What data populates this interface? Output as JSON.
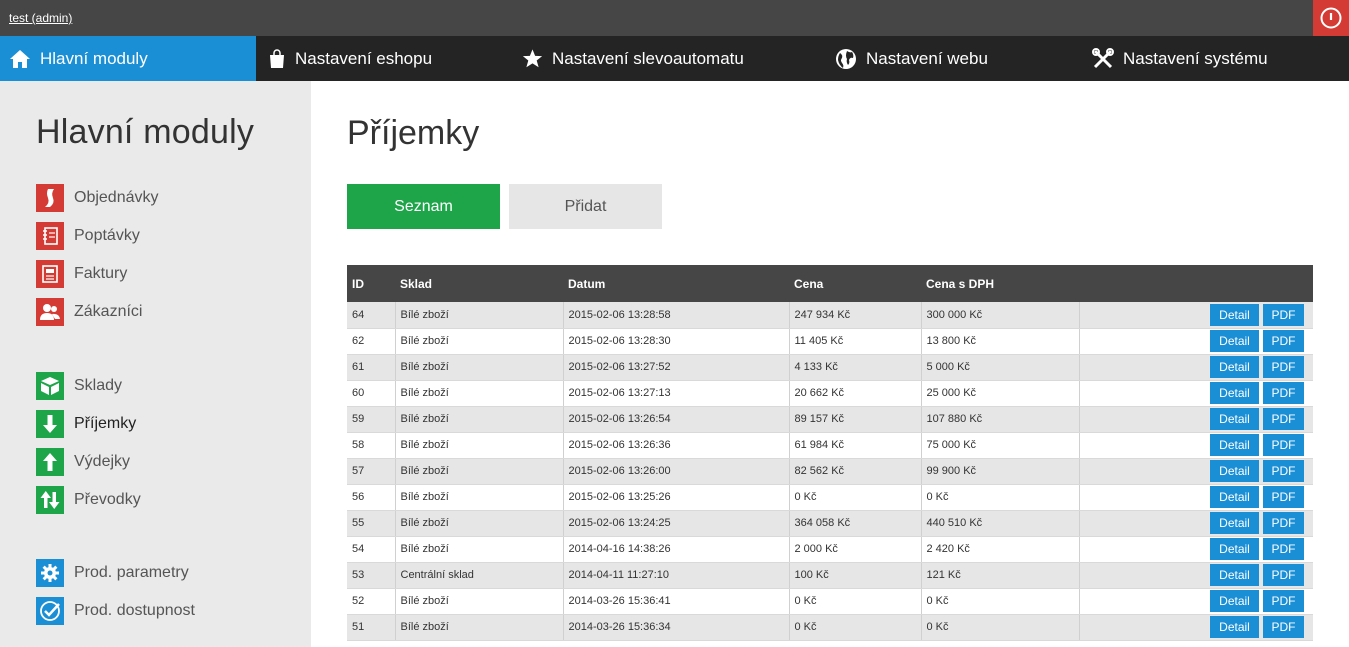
{
  "user": {
    "label": "test (admin)"
  },
  "nav": {
    "items": [
      {
        "label": "Hlavní moduly",
        "icon": "home-icon"
      },
      {
        "label": "Nastavení eshopu",
        "icon": "shopping-bag-icon"
      },
      {
        "label": "Nastavení slevoautomatu",
        "icon": "star-icon"
      },
      {
        "label": "Nastavení webu",
        "icon": "globe-icon"
      },
      {
        "label": "Nastavení systému",
        "icon": "tools-icon"
      }
    ]
  },
  "sidebar": {
    "title": "Hlavní moduly",
    "items": [
      {
        "label": "Objednávky",
        "icon": "order-icon",
        "color": "#d43b34"
      },
      {
        "label": "Poptávky",
        "icon": "notebook-icon",
        "color": "#d43b34"
      },
      {
        "label": "Faktury",
        "icon": "invoice-icon",
        "color": "#d43b34"
      },
      {
        "label": "Zákazníci",
        "icon": "customers-icon",
        "color": "#d43b34"
      },
      {
        "label": "Sklady",
        "icon": "warehouse-icon",
        "color": "#1ea54a"
      },
      {
        "label": "Příjemky",
        "icon": "arrow-down-icon",
        "color": "#1ea54a"
      },
      {
        "label": "Výdejky",
        "icon": "arrow-up-icon",
        "color": "#1ea54a"
      },
      {
        "label": "Převodky",
        "icon": "transfer-icon",
        "color": "#1ea54a"
      },
      {
        "label": "Prod. parametry",
        "icon": "gear-icon",
        "color": "#1b8fd6"
      },
      {
        "label": "Prod. dostupnost",
        "icon": "check-icon",
        "color": "#1b8fd6"
      }
    ]
  },
  "page": {
    "title": "Příjemky"
  },
  "tabs": {
    "list_label": "Seznam",
    "add_label": "Přidat"
  },
  "table": {
    "headers": [
      "ID",
      "Sklad",
      "Datum",
      "Cena",
      "Cena s DPH"
    ],
    "detail_label": "Detail",
    "pdf_label": "PDF",
    "rows": [
      {
        "id": "64",
        "sklad": "Bílé zboží",
        "datum": "2015-02-06 13:28:58",
        "cena": "247 934 Kč",
        "cena_dph": "300 000 Kč"
      },
      {
        "id": "62",
        "sklad": "Bílé zboží",
        "datum": "2015-02-06 13:28:30",
        "cena": "11 405 Kč",
        "cena_dph": "13 800 Kč"
      },
      {
        "id": "61",
        "sklad": "Bílé zboží",
        "datum": "2015-02-06 13:27:52",
        "cena": "4 133 Kč",
        "cena_dph": "5 000 Kč"
      },
      {
        "id": "60",
        "sklad": "Bílé zboží",
        "datum": "2015-02-06 13:27:13",
        "cena": "20 662 Kč",
        "cena_dph": "25 000 Kč"
      },
      {
        "id": "59",
        "sklad": "Bílé zboží",
        "datum": "2015-02-06 13:26:54",
        "cena": "89 157 Kč",
        "cena_dph": "107 880 Kč"
      },
      {
        "id": "58",
        "sklad": "Bílé zboží",
        "datum": "2015-02-06 13:26:36",
        "cena": "61 984 Kč",
        "cena_dph": "75 000 Kč"
      },
      {
        "id": "57",
        "sklad": "Bílé zboží",
        "datum": "2015-02-06 13:26:00",
        "cena": "82 562 Kč",
        "cena_dph": "99 900 Kč"
      },
      {
        "id": "56",
        "sklad": "Bílé zboží",
        "datum": "2015-02-06 13:25:26",
        "cena": "0 Kč",
        "cena_dph": "0 Kč"
      },
      {
        "id": "55",
        "sklad": "Bílé zboží",
        "datum": "2015-02-06 13:24:25",
        "cena": "364 058 Kč",
        "cena_dph": "440 510 Kč"
      },
      {
        "id": "54",
        "sklad": "Bílé zboží",
        "datum": "2014-04-16 14:38:26",
        "cena": "2 000 Kč",
        "cena_dph": "2 420 Kč"
      },
      {
        "id": "53",
        "sklad": "Centrální sklad",
        "datum": "2014-04-11 11:27:10",
        "cena": "100 Kč",
        "cena_dph": "121 Kč"
      },
      {
        "id": "52",
        "sklad": "Bílé zboží",
        "datum": "2014-03-26 15:36:41",
        "cena": "0 Kč",
        "cena_dph": "0 Kč"
      },
      {
        "id": "51",
        "sklad": "Bílé zboží",
        "datum": "2014-03-26 15:36:34",
        "cena": "0 Kč",
        "cena_dph": "0 Kč"
      }
    ]
  }
}
